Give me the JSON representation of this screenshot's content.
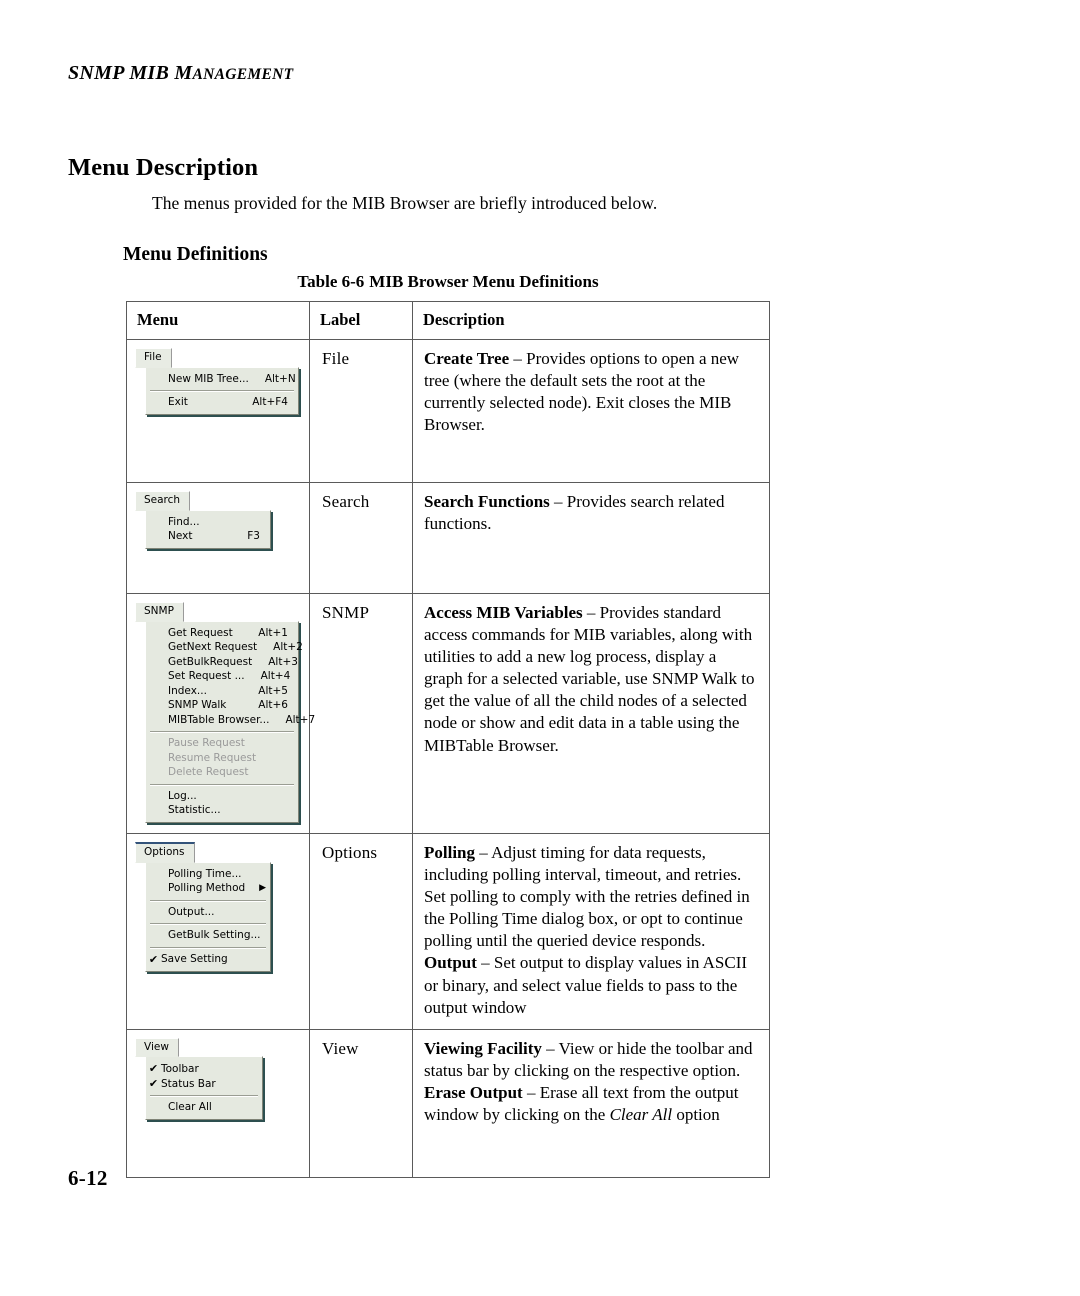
{
  "page": {
    "running_head": "SNMP MIB M",
    "running_head_small": "ANAGEMENT",
    "folio": "6-12"
  },
  "section": {
    "heading": "Menu Description",
    "intro": "The menus provided for the MIB Browser are briefly introduced below.",
    "subheading": "Menu Definitions"
  },
  "table": {
    "caption_number": "Table 6-6",
    "caption_text": "MIB Browser Menu Definitions",
    "headers": {
      "menu": "Menu",
      "label": "Label",
      "description": "Description"
    },
    "rows": [
      {
        "label": "File",
        "menu_widget": {
          "tab": "File",
          "items": [
            {
              "label": "New MIB Tree...",
              "accel": "Alt+N",
              "disabled": false,
              "checked": false,
              "submenu": false
            },
            {
              "separator": true
            },
            {
              "label": "Exit",
              "accel": "Alt+F4",
              "disabled": false,
              "checked": false,
              "submenu": false
            }
          ]
        },
        "description": [
          {
            "bold": "Create Tree",
            "dash": " – ",
            "text": "Provides options to open a new tree (where the default sets the root at the currently selected node). Exit closes the MIB Browser."
          }
        ]
      },
      {
        "label": "Search",
        "menu_widget": {
          "tab": "Search",
          "items": [
            {
              "label": "Find...",
              "accel": "",
              "disabled": false,
              "checked": false,
              "submenu": false
            },
            {
              "label": "Next",
              "accel": "F3",
              "disabled": false,
              "checked": false,
              "submenu": false
            }
          ]
        },
        "description": [
          {
            "bold": "Search Functions",
            "dash": " – ",
            "text": "Provides search related functions."
          }
        ]
      },
      {
        "label": "SNMP",
        "menu_widget": {
          "tab": "SNMP",
          "items": [
            {
              "label": "Get Request",
              "accel": "Alt+1",
              "disabled": false,
              "checked": false,
              "submenu": false
            },
            {
              "label": "GetNext Request",
              "accel": "Alt+2",
              "disabled": false,
              "checked": false,
              "submenu": false
            },
            {
              "label": "GetBulkRequest",
              "accel": "Alt+3",
              "disabled": false,
              "checked": false,
              "submenu": false
            },
            {
              "label": "Set Request ...",
              "accel": "Alt+4",
              "disabled": false,
              "checked": false,
              "submenu": false
            },
            {
              "label": "Index...",
              "accel": "Alt+5",
              "disabled": false,
              "checked": false,
              "submenu": false
            },
            {
              "label": "SNMP Walk",
              "accel": "Alt+6",
              "disabled": false,
              "checked": false,
              "submenu": false
            },
            {
              "label": "MIBTable Browser...",
              "accel": "Alt+7",
              "disabled": false,
              "checked": false,
              "submenu": false
            },
            {
              "separator": true
            },
            {
              "label": "Pause Request",
              "accel": "",
              "disabled": true,
              "checked": false,
              "submenu": false
            },
            {
              "label": "Resume Request",
              "accel": "",
              "disabled": true,
              "checked": false,
              "submenu": false
            },
            {
              "label": "Delete Request",
              "accel": "",
              "disabled": true,
              "checked": false,
              "submenu": false
            },
            {
              "separator": true
            },
            {
              "label": "Log...",
              "accel": "",
              "disabled": false,
              "checked": false,
              "submenu": false
            },
            {
              "label": "Statistic...",
              "accel": "",
              "disabled": false,
              "checked": false,
              "submenu": false
            }
          ]
        },
        "description": [
          {
            "bold": "Access MIB Variables",
            "dash": " – ",
            "text": "Provides standard access commands for MIB variables, along with utilities to add a new log process, display a graph for a selected variable, use SNMP Walk to get the value of all the child nodes of a selected node or show and edit data in a table using the MIBTable Browser."
          }
        ]
      },
      {
        "label": "Options",
        "menu_widget": {
          "tab": "Options",
          "items": [
            {
              "label": "Polling Time...",
              "accel": "",
              "disabled": false,
              "checked": false,
              "submenu": false
            },
            {
              "label": "Polling Method",
              "accel": "",
              "disabled": false,
              "checked": false,
              "submenu": true
            },
            {
              "separator": true
            },
            {
              "label": "Output...",
              "accel": "",
              "disabled": false,
              "checked": false,
              "submenu": false
            },
            {
              "separator": true
            },
            {
              "label": "GetBulk Setting...",
              "accel": "",
              "disabled": false,
              "checked": false,
              "submenu": false
            },
            {
              "separator": true
            },
            {
              "label": "Save Setting",
              "accel": "",
              "disabled": false,
              "checked": true,
              "submenu": false
            }
          ]
        },
        "description": [
          {
            "bold": "Polling",
            "dash": " – ",
            "text": "Adjust timing for data requests, including polling interval, timeout, and retries. Set polling to comply with the retries defined in the Polling Time dialog box, or opt to continue polling until the queried device responds."
          },
          {
            "bold": "Output",
            "dash": " – ",
            "text": "Set output to display values in ASCII or binary, and select value fields to pass to the output window"
          }
        ]
      },
      {
        "label": "View",
        "menu_widget": {
          "tab": "View",
          "items": [
            {
              "label": "Toolbar",
              "accel": "",
              "disabled": false,
              "checked": true,
              "submenu": false
            },
            {
              "label": "Status Bar",
              "accel": "",
              "disabled": false,
              "checked": true,
              "submenu": false
            },
            {
              "separator": true
            },
            {
              "label": "Clear All",
              "accel": "",
              "disabled": false,
              "checked": false,
              "submenu": false
            }
          ]
        },
        "description": [
          {
            "bold": "Viewing Facility",
            "dash": " – ",
            "text": "View or hide the toolbar and status bar by clicking on the respective option."
          },
          {
            "bold": "Erase Output",
            "dash": " – ",
            "text": "Erase all text from the output window by clicking on the ",
            "italic": "Clear All",
            "text_after": " option"
          }
        ]
      }
    ]
  },
  "icons": {
    "checkmark": "✔",
    "submenu_arrow": "▶"
  },
  "colors": {
    "menu_face": "#e5e9e0",
    "menu_tab_face": "#e8ece4",
    "menu_shadow": "#2d4f4f",
    "table_border": "#5a5a5a",
    "disabled_text": "#9a9a9a",
    "accent_blue": "#33537a"
  }
}
